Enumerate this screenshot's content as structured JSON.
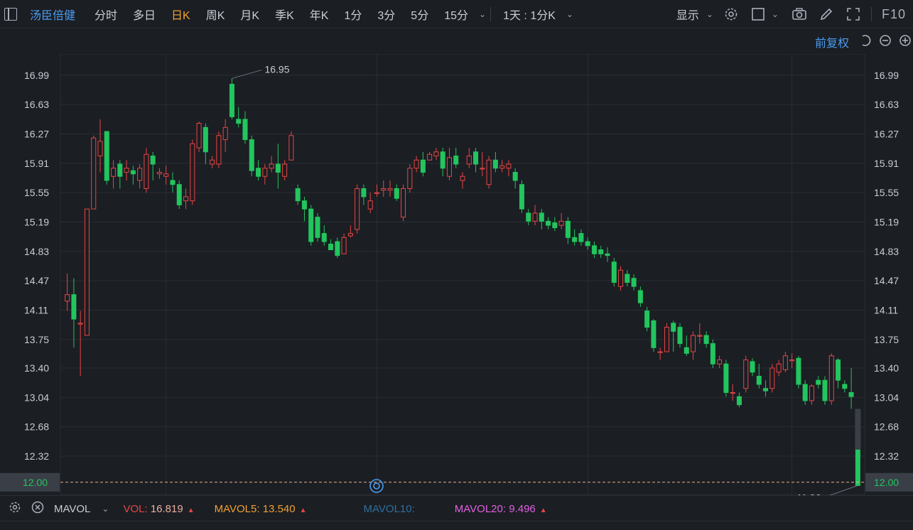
{
  "toolbar": {
    "stock_name": "汤臣倍健",
    "periods": [
      "分时",
      "多日",
      "日K",
      "周K",
      "月K",
      "季K",
      "年K",
      "1分",
      "3分",
      "5分",
      "15分"
    ],
    "active_period": "日K",
    "interval_select": "1天 : 1分K",
    "display_label": "显示",
    "f10_label": "F10"
  },
  "adjust_label": "前复权",
  "chart_data": {
    "type": "candlestick",
    "y_ticks": [
      "16.99",
      "16.63",
      "16.27",
      "15.91",
      "15.55",
      "15.19",
      "14.83",
      "14.47",
      "14.11",
      "13.75",
      "13.40",
      "13.04",
      "12.68",
      "12.32"
    ],
    "ylim": [
      11.85,
      17.25
    ],
    "current_price": "12.00",
    "high_label": "16.95",
    "low_label": "11.96",
    "colors": {
      "up": "#e84545",
      "down": "#22c55e",
      "background": "#1b1e23",
      "grid": "#2a2e35",
      "last_price": "#e8b08a",
      "current_box": "#3a3f47"
    },
    "candles": [
      [
        14.22,
        14.3,
        14.56,
        14.1
      ],
      [
        14.3,
        14.0,
        14.5,
        13.65
      ],
      [
        13.95,
        13.95,
        14.1,
        13.3
      ],
      [
        13.8,
        15.35,
        15.35,
        13.8
      ],
      [
        15.35,
        16.22,
        16.25,
        15.35
      ],
      [
        16.0,
        16.18,
        16.45,
        15.8
      ],
      [
        16.3,
        15.7,
        16.3,
        15.65
      ],
      [
        15.75,
        15.85,
        15.95,
        15.6
      ],
      [
        15.9,
        15.75,
        15.95,
        15.6
      ],
      [
        15.8,
        15.85,
        15.95,
        15.7
      ],
      [
        15.82,
        15.78,
        15.88,
        15.65
      ],
      [
        15.7,
        15.85,
        15.9,
        15.6
      ],
      [
        15.6,
        16.02,
        16.1,
        15.55
      ],
      [
        16.0,
        15.9,
        16.05,
        15.7
      ],
      [
        15.78,
        15.8,
        15.85,
        15.72
      ],
      [
        15.75,
        15.78,
        15.88,
        15.65
      ],
      [
        15.7,
        15.65,
        15.8,
        15.55
      ],
      [
        15.65,
        15.4,
        15.7,
        15.35
      ],
      [
        15.45,
        15.5,
        15.6,
        15.35
      ],
      [
        15.45,
        16.15,
        16.2,
        15.4
      ],
      [
        16.1,
        16.4,
        16.42,
        16.05
      ],
      [
        16.35,
        16.05,
        16.4,
        15.9
      ],
      [
        15.9,
        15.95,
        16.0,
        15.85
      ],
      [
        15.9,
        16.25,
        16.3,
        15.85
      ],
      [
        16.2,
        16.35,
        16.45,
        16.05
      ],
      [
        16.88,
        16.48,
        16.95,
        16.45
      ],
      [
        16.45,
        16.4,
        16.6,
        16.35
      ],
      [
        16.45,
        16.2,
        16.55,
        16.15
      ],
      [
        16.2,
        15.82,
        16.25,
        15.75
      ],
      [
        15.85,
        15.75,
        15.95,
        15.7
      ],
      [
        15.75,
        15.85,
        15.9,
        15.65
      ],
      [
        15.85,
        15.9,
        16.0,
        15.8
      ],
      [
        15.9,
        15.8,
        16.15,
        15.6
      ],
      [
        15.75,
        15.9,
        15.95,
        15.7
      ],
      [
        15.95,
        16.25,
        16.3,
        15.95
      ],
      [
        15.6,
        15.45,
        15.65,
        15.4
      ],
      [
        15.45,
        15.35,
        15.5,
        15.2
      ],
      [
        15.35,
        14.95,
        15.4,
        14.9
      ],
      [
        15.25,
        15.0,
        15.3,
        14.95
      ],
      [
        15.05,
        14.95,
        15.15,
        14.9
      ],
      [
        14.92,
        14.85,
        14.98,
        14.85
      ],
      [
        14.95,
        14.78,
        15.0,
        14.75
      ],
      [
        14.8,
        15.0,
        15.05,
        14.8
      ],
      [
        15.02,
        15.05,
        15.15,
        15.0
      ],
      [
        15.1,
        15.6,
        15.65,
        15.05
      ],
      [
        15.6,
        15.5,
        15.65,
        15.4
      ],
      [
        15.35,
        15.45,
        15.55,
        15.3
      ],
      [
        15.55,
        15.55,
        15.65,
        15.5
      ],
      [
        15.58,
        15.6,
        15.7,
        15.5
      ],
      [
        15.58,
        15.6,
        15.7,
        15.5
      ],
      [
        15.6,
        15.48,
        15.65,
        15.45
      ],
      [
        15.25,
        15.6,
        15.65,
        15.2
      ],
      [
        15.6,
        15.85,
        15.9,
        15.55
      ],
      [
        15.85,
        15.95,
        16.0,
        15.8
      ],
      [
        15.95,
        15.8,
        16.05,
        15.75
      ],
      [
        15.95,
        16.02,
        16.05,
        15.95
      ],
      [
        16.0,
        16.05,
        16.1,
        15.95
      ],
      [
        16.05,
        15.85,
        16.1,
        15.75
      ],
      [
        15.75,
        15.98,
        16.1,
        15.7
      ],
      [
        16.0,
        15.9,
        16.1,
        15.85
      ],
      [
        15.7,
        15.75,
        15.8,
        15.6
      ],
      [
        15.9,
        16.0,
        16.1,
        15.85
      ],
      [
        16.05,
        15.9,
        16.1,
        15.8
      ],
      [
        15.85,
        15.85,
        16.05,
        15.75
      ],
      [
        15.65,
        15.95,
        16.0,
        15.6
      ],
      [
        15.95,
        15.85,
        16.05,
        15.8
      ],
      [
        15.85,
        15.88,
        15.95,
        15.8
      ],
      [
        15.85,
        15.9,
        15.95,
        15.75
      ],
      [
        15.8,
        15.7,
        15.85,
        15.6
      ],
      [
        15.65,
        15.35,
        15.7,
        15.3
      ],
      [
        15.3,
        15.2,
        15.35,
        15.15
      ],
      [
        15.2,
        15.3,
        15.4,
        15.15
      ],
      [
        15.3,
        15.2,
        15.35,
        15.1
      ],
      [
        15.2,
        15.15,
        15.25,
        15.1
      ],
      [
        15.18,
        15.12,
        15.25,
        15.08
      ],
      [
        15.15,
        15.2,
        15.3,
        15.1
      ],
      [
        15.2,
        15.0,
        15.25,
        14.92
      ],
      [
        15.0,
        14.95,
        15.1,
        14.9
      ],
      [
        15.05,
        14.95,
        15.1,
        14.9
      ],
      [
        14.95,
        14.9,
        15.0,
        14.85
      ],
      [
        14.9,
        14.8,
        14.95,
        14.75
      ],
      [
        14.85,
        14.8,
        14.9,
        14.75
      ],
      [
        14.8,
        14.78,
        14.88,
        14.7
      ],
      [
        14.7,
        14.45,
        14.75,
        14.4
      ],
      [
        14.4,
        14.6,
        14.65,
        14.35
      ],
      [
        14.55,
        14.45,
        14.6,
        14.4
      ],
      [
        14.5,
        14.4,
        14.55,
        14.35
      ],
      [
        14.35,
        14.2,
        14.4,
        14.15
      ],
      [
        14.1,
        13.9,
        14.15,
        13.85
      ],
      [
        13.98,
        13.65,
        14.0,
        13.6
      ],
      [
        13.6,
        13.6,
        13.65,
        13.5
      ],
      [
        13.6,
        13.9,
        13.95,
        13.6
      ],
      [
        13.95,
        13.85,
        13.98,
        13.6
      ],
      [
        13.9,
        13.7,
        13.95,
        13.65
      ],
      [
        13.65,
        13.58,
        13.8,
        13.55
      ],
      [
        13.6,
        13.8,
        13.85,
        13.5
      ],
      [
        13.8,
        13.8,
        13.95,
        13.7
      ],
      [
        13.8,
        13.7,
        13.85,
        13.65
      ],
      [
        13.7,
        13.45,
        13.75,
        13.4
      ],
      [
        13.45,
        13.5,
        13.55,
        13.4
      ],
      [
        13.45,
        13.1,
        13.5,
        13.05
      ],
      [
        13.1,
        13.1,
        13.2,
        13.0
      ],
      [
        13.05,
        12.95,
        13.1,
        12.92
      ],
      [
        13.15,
        13.5,
        13.55,
        13.1
      ],
      [
        13.48,
        13.35,
        13.52,
        13.3
      ],
      [
        13.3,
        13.2,
        13.45,
        13.15
      ],
      [
        13.15,
        13.12,
        13.25,
        13.05
      ],
      [
        13.15,
        13.4,
        13.45,
        13.1
      ],
      [
        13.35,
        13.45,
        13.5,
        13.3
      ],
      [
        13.38,
        13.55,
        13.6,
        13.35
      ],
      [
        13.5,
        13.5,
        13.58,
        13.4
      ],
      [
        13.52,
        13.2,
        13.55,
        13.15
      ],
      [
        13.2,
        13.0,
        13.25,
        12.95
      ],
      [
        13.0,
        13.18,
        13.2,
        12.95
      ],
      [
        13.25,
        13.2,
        13.3,
        13.15
      ],
      [
        13.25,
        13.0,
        13.3,
        12.95
      ],
      [
        13.0,
        13.55,
        13.58,
        12.95
      ],
      [
        13.5,
        13.25,
        13.52,
        13.15
      ],
      [
        13.2,
        13.15,
        13.25,
        13.1
      ],
      [
        13.1,
        13.05,
        13.4,
        12.9
      ],
      [
        12.4,
        11.96,
        12.4,
        11.96
      ]
    ]
  },
  "volume_bar": {
    "indicator": "MAVOL",
    "vol_label": "VOL:",
    "vol_value": "16.819",
    "mavol5_label": "MAVOL5:",
    "mavol5_value": "13.540",
    "mavol10_label": "MAVOL10:",
    "mavol20_label": "MAVOL20:",
    "mavol20_value": "9.496",
    "colors": {
      "vol": "#e84545",
      "mavol5": "#f0a030",
      "mavol10": "#4a9cf0",
      "mavol20": "#e060e0"
    }
  }
}
